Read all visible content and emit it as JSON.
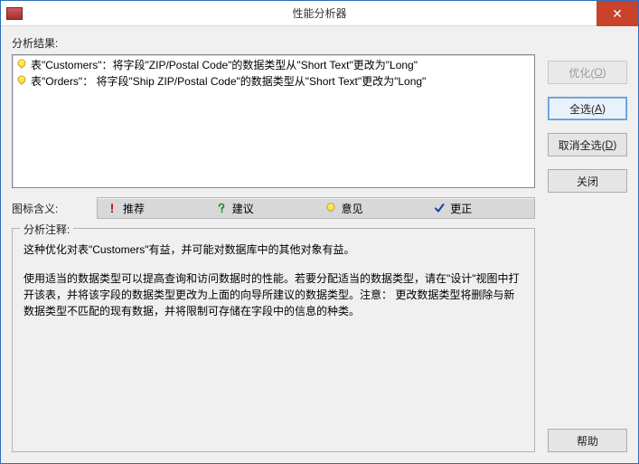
{
  "window": {
    "title": "性能分析器",
    "close": "✕"
  },
  "sections": {
    "results_label": "分析结果:",
    "legend_label": "图标含义:",
    "notes_legend": "分析注释:"
  },
  "results": [
    {
      "icon": "bulb",
      "text": "表\"Customers\"：将字段\"ZIP/Postal Code\"的数据类型从\"Short Text\"更改为\"Long\""
    },
    {
      "icon": "bulb",
      "text": "表\"Orders\"： 将字段\"Ship ZIP/Postal Code\"的数据类型从\"Short Text\"更改为\"Long\""
    }
  ],
  "legend": {
    "items": [
      {
        "icon": "exclaim",
        "label": "推荐"
      },
      {
        "icon": "question",
        "label": "建议"
      },
      {
        "icon": "bulb",
        "label": "意见"
      },
      {
        "icon": "check",
        "label": "更正"
      }
    ]
  },
  "notes": {
    "p1": "这种优化对表\"Customers\"有益，并可能对数据库中的其他对象有益。",
    "p2": "使用适当的数据类型可以提高查询和访问数据时的性能。若要分配适当的数据类型，请在\"设计\"视图中打开该表，并将该字段的数据类型更改为上面的向导所建议的数据类型。注意： 更改数据类型将删除与新数据类型不匹配的现有数据，并将限制可存储在字段中的信息的种类。"
  },
  "buttons": {
    "optimize": {
      "text": "优化(",
      "accel": "O",
      "tail": ")",
      "enabled": false
    },
    "select_all": {
      "text": "全选(",
      "accel": "A",
      "tail": ")",
      "enabled": true,
      "focused": true
    },
    "deselect_all": {
      "text": "取消全选(",
      "accel": "D",
      "tail": ")",
      "enabled": true
    },
    "close": {
      "text": "关闭",
      "enabled": true
    },
    "help": {
      "text": "帮助",
      "enabled": true
    }
  }
}
